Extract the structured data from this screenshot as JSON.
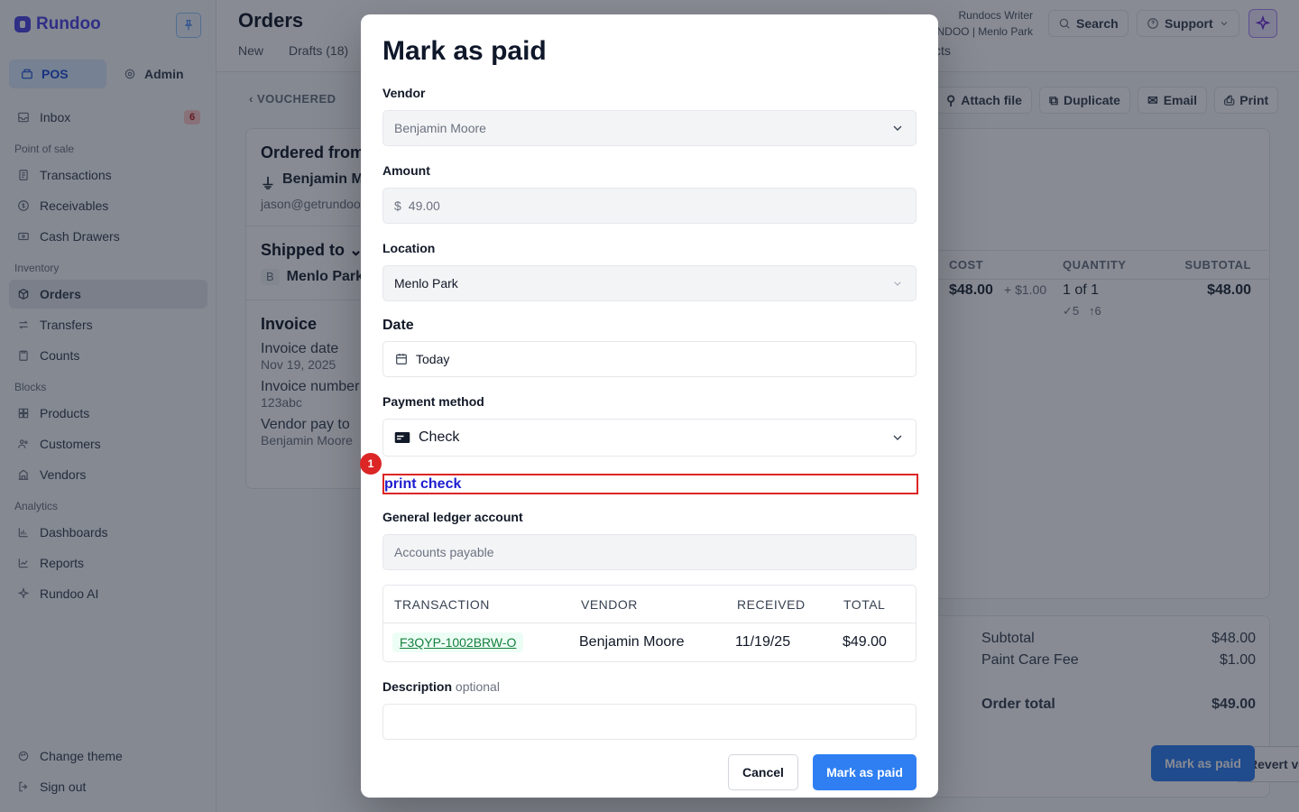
{
  "sidebar": {
    "brand": "Rundoo",
    "modes": [
      {
        "label": "POS"
      },
      {
        "label": "Admin"
      }
    ],
    "items": [
      {
        "label": "Inbox",
        "badge": "6",
        "icon": "inbox-icon"
      },
      {
        "label": "Transactions",
        "icon": "list-icon"
      },
      {
        "label": "Receivables",
        "icon": "dollar-icon"
      },
      {
        "label": "Cash Drawers",
        "icon": "cash-icon"
      },
      {
        "label": "Orders",
        "icon": "box-icon"
      },
      {
        "label": "Transfers",
        "icon": "swap-icon"
      },
      {
        "label": "Counts",
        "icon": "clipboard-icon"
      },
      {
        "label": "Products",
        "icon": "grid-icon"
      },
      {
        "label": "Customers",
        "icon": "users-icon"
      },
      {
        "label": "Vendors",
        "icon": "building-icon"
      },
      {
        "label": "Dashboards",
        "icon": "dashboard-icon"
      },
      {
        "label": "Reports",
        "icon": "chart-icon"
      },
      {
        "label": "Rundoo AI",
        "icon": "sparkle-icon"
      }
    ],
    "sections": [
      "Point of sale",
      "Inventory",
      "Blocks",
      "Analytics"
    ],
    "bottom": [
      {
        "label": "Change theme"
      },
      {
        "label": "Sign out"
      }
    ]
  },
  "header": {
    "title": "Orders",
    "tabs": [
      "New",
      "Drafts (18)"
    ],
    "tab_right": "cts",
    "account_name": "Rundocs Writer",
    "account_store": "NDOO | Menlo Park",
    "search_label": "Search",
    "support_label": "Support"
  },
  "order": {
    "back_label": "VOUCHERED",
    "actions": [
      "Attach file",
      "Duplicate",
      "Email",
      "Print"
    ],
    "ordered_from_title": "Ordered from",
    "vendor_name": "Benjamin M",
    "vendor_email": "jason@getrundoo",
    "shipped_to_title": "Shipped to",
    "location_initial": "B",
    "location_name": "Menlo Park",
    "invoice_title": "Invoice",
    "invoice_date_label": "Invoice date",
    "invoice_date": "Nov 19, 2025",
    "invoice_number_label": "Invoice number",
    "invoice_number": "123abc",
    "vendor_pay_to_label": "Vendor pay to",
    "vendor_pay_to": "Benjamin Moore",
    "item_headers": [
      "COST",
      "QUANTITY",
      "SUBTOTAL"
    ],
    "item_cost": "$48.00",
    "item_fee": "+ $1.00",
    "item_qty": "1 of 1",
    "item_sub_received": "✓5",
    "item_sub_ordered": "↑6",
    "item_subtotal": "$48.00",
    "subtotal_label": "Subtotal",
    "subtotal": "$48.00",
    "fee_label": "Paint Care Fee",
    "fee": "$1.00",
    "order_total_label": "Order total",
    "order_total": "$49.00",
    "revert_label": "Revert voucher",
    "mark_paid_label": "Mark as paid"
  },
  "modal": {
    "title": "Mark as paid",
    "vendor_label": "Vendor",
    "vendor_value": "Benjamin Moore",
    "amount_label": "Amount",
    "amount_prefix": "$",
    "amount_value": "49.00",
    "location_label": "Location",
    "location_value": "Menlo Park",
    "date_label": "Date",
    "date_value": "Today",
    "payment_label": "Payment method",
    "payment_value": "Check",
    "print_check": "print check",
    "marker": "1",
    "gl_label": "General ledger account",
    "gl_placeholder": "Accounts payable",
    "table_headers": [
      "TRANSACTION",
      "VENDOR",
      "RECEIVED",
      "TOTAL"
    ],
    "row": {
      "transaction": "F3QYP-1002BRW-O",
      "vendor": "Benjamin Moore",
      "received": "11/19/25",
      "total": "$49.00"
    },
    "description_label": "Description",
    "description_optional": "optional",
    "description_value": "",
    "cancel_label": "Cancel",
    "submit_label": "Mark as paid"
  },
  "colors": {
    "accent": "#2f7ff2",
    "brand": "#4f46e5",
    "highlight": "#dc2626"
  }
}
